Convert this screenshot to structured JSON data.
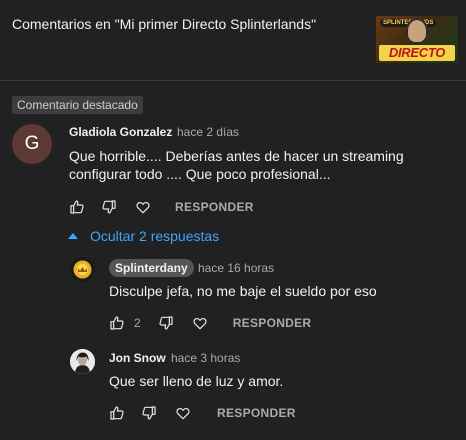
{
  "header": {
    "title": "Comentarios en \"Mi primer Directo Splinterlands\"",
    "thumbnail_text": "DIRECTO",
    "thumbnail_badge": "SPLINTERLANDS"
  },
  "pinned_label": "Comentario destacado",
  "comment": {
    "avatar_letter": "G",
    "author": "Gladiola Gonzalez",
    "time": "hace 2 días",
    "text_line1": "Que horrible.... Deberías  antes de hacer un streaming",
    "text_line2": "configurar todo .... Que poco profesional...",
    "reply_label": "RESPONDER"
  },
  "replies_toggle": "Ocultar 2 respuestas",
  "replies": [
    {
      "author": "Splinterdany",
      "time": "hace 16 horas",
      "text": "Disculpe jefa, no me baje el sueldo por eso",
      "likes": "2",
      "reply_label": "RESPONDER"
    },
    {
      "author": "Jon Snow",
      "time": "hace 3 horas",
      "text": "Que ser lleno de luz y amor.",
      "reply_label": "RESPONDER"
    }
  ],
  "colors": {
    "background": "#212121",
    "link": "#3ea6ff",
    "secondary_text": "#aaaaaa",
    "avatar_g": "#5c3a34"
  },
  "icons": [
    "thumbs-up-icon",
    "thumbs-down-icon",
    "heart-icon",
    "chevron-up-icon"
  ]
}
